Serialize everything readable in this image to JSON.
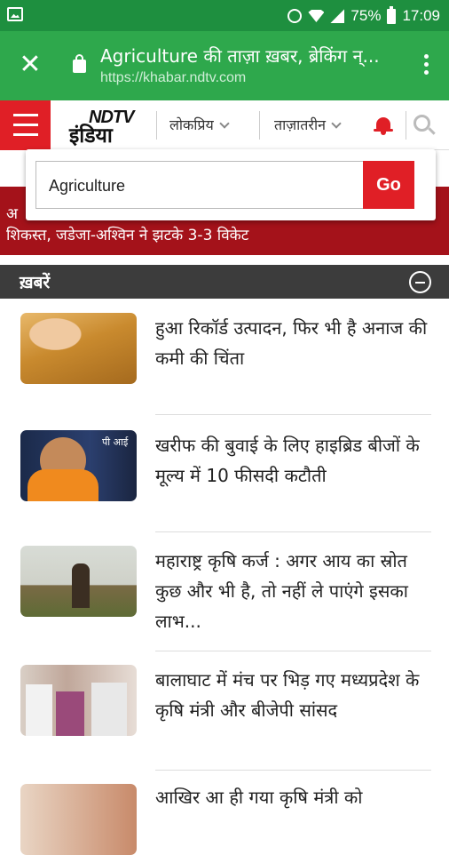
{
  "status_bar": {
    "battery": "75%",
    "time": "17:09",
    "icons": [
      "gallery-icon",
      "alarm-icon",
      "wifi-icon",
      "signal-icon",
      "battery-icon"
    ]
  },
  "browser": {
    "page_title": "Agriculture की ताज़ा ख़बर, ब्रेकिंग न्...",
    "url": "https://khabar.ndtv.com",
    "brand_color": "#2ea84c",
    "status_color": "#1e8f3f"
  },
  "site_header": {
    "logo_ndtv": "NDTV",
    "logo_india": "इंडिया",
    "nav": [
      "लोकप्रिय",
      "ताज़ातरीन"
    ],
    "accent": "#e01f26"
  },
  "search": {
    "value": "Agriculture",
    "go_label": "Go"
  },
  "breaking": {
    "fragment": "अ",
    "text": "शिकस्त, जडेजा-अश्विन ने झटके 3-3 विकेट"
  },
  "section": {
    "title": "ख़बरें"
  },
  "news": [
    {
      "headline": "हुआ रिकॉर्ड उत्पादन, फिर भी है अनाज की कमी की चिंता"
    },
    {
      "headline": "खरीफ की बुवाई के लिए हाइब्रिड बीजों के मूल्य में 10 फीसदी कटौती",
      "thumb_text": "पी आई"
    },
    {
      "headline": "महाराष्ट्र कृषि कर्ज : अगर आय का स्रोत कुछ और भी है, तो नहीं ले पाएंगे इसका लाभ..."
    },
    {
      "headline": "बालाघाट में मंच पर भिड़ गए मध्यप्रदेश के कृषि मंत्री और बीजेपी सांसद"
    },
    {
      "headline": "आखिर आ ही गया कृषि मंत्री को"
    }
  ]
}
